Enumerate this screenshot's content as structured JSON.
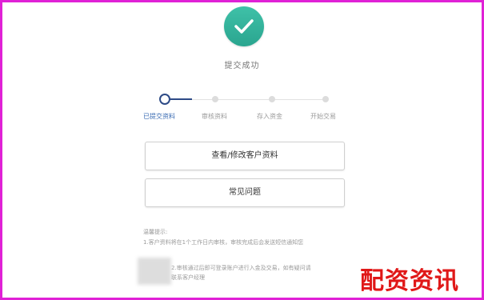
{
  "status": {
    "icon": "checkmark-icon",
    "accent_color": "#2fb59c",
    "text": "提交成功"
  },
  "steps": [
    {
      "label": "已提交资料",
      "state": "active"
    },
    {
      "label": "审核资料",
      "state": "pending"
    },
    {
      "label": "存入资金",
      "state": "pending"
    },
    {
      "label": "开始交易",
      "state": "pending"
    }
  ],
  "buttons": {
    "view_edit_label": "查看/修改客户资料",
    "faq_label": "常见问题"
  },
  "notes": {
    "title": "温馨提示:",
    "line1": "1.客户资料将在1个工作日内审核，审核完成后会发送短信通知您",
    "line2": "2.审核通过后即可登录账户进行入金及交易，如有疑问请",
    "line3": "联系客户经理"
  },
  "watermark": "配资资讯",
  "colors": {
    "frame": "#e021d6",
    "progress_active": "#2d4a86",
    "step_active_text": "#3b6cb3",
    "watermark": "#e01818"
  }
}
